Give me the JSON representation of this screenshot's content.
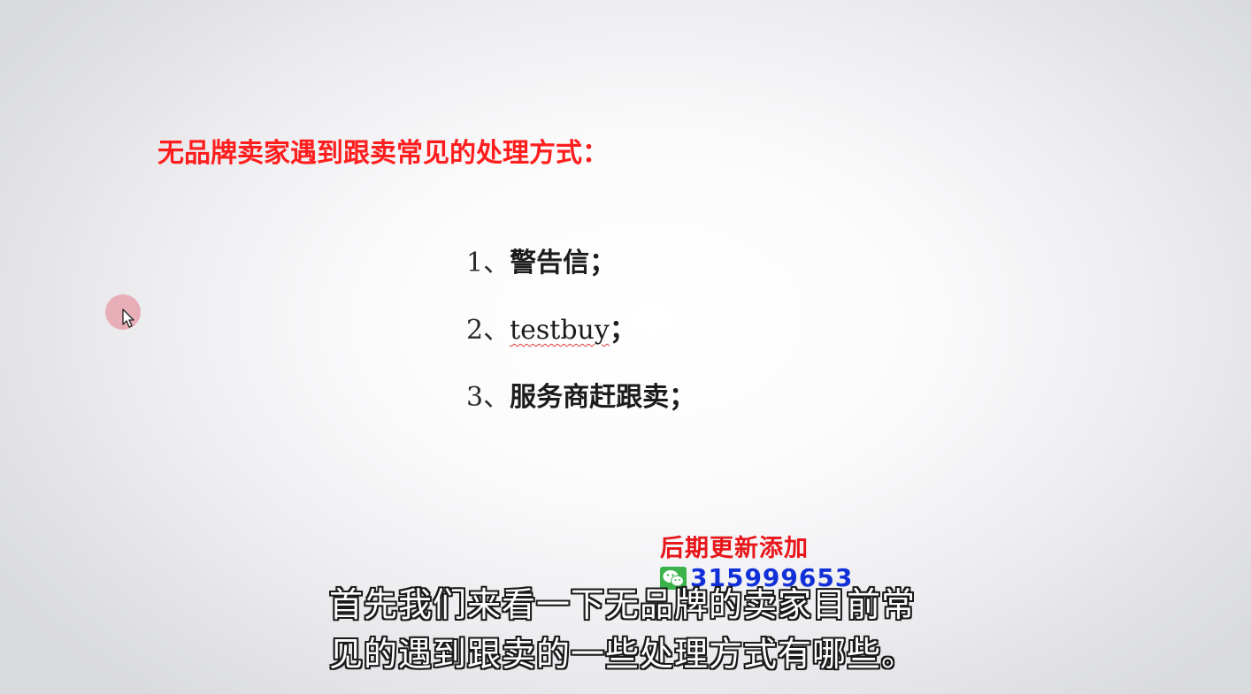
{
  "slide": {
    "title": "无品牌卖家遇到跟卖常见的处理方式：",
    "items": [
      {
        "number": "1、",
        "text": "警告信",
        "punct": "；"
      },
      {
        "number": "2、",
        "text": "testbuy",
        "punct": "；"
      },
      {
        "number": "3、",
        "text": "服务商赶跟卖",
        "punct": "；"
      }
    ]
  },
  "watermark": {
    "line1": "后期更新添加",
    "icon": "wechat-icon",
    "number": "315999653"
  },
  "subtitles": [
    "首先我们来看一下无品牌的卖家目前常",
    "见的遇到跟卖的一些处理方式有哪些。"
  ],
  "colors": {
    "title": "#ff1e1e",
    "watermark_text": "#e8161a",
    "watermark_number": "#1230d8",
    "wechat_green": "#3bb34a",
    "cursor_highlight": "#e79aa6"
  }
}
